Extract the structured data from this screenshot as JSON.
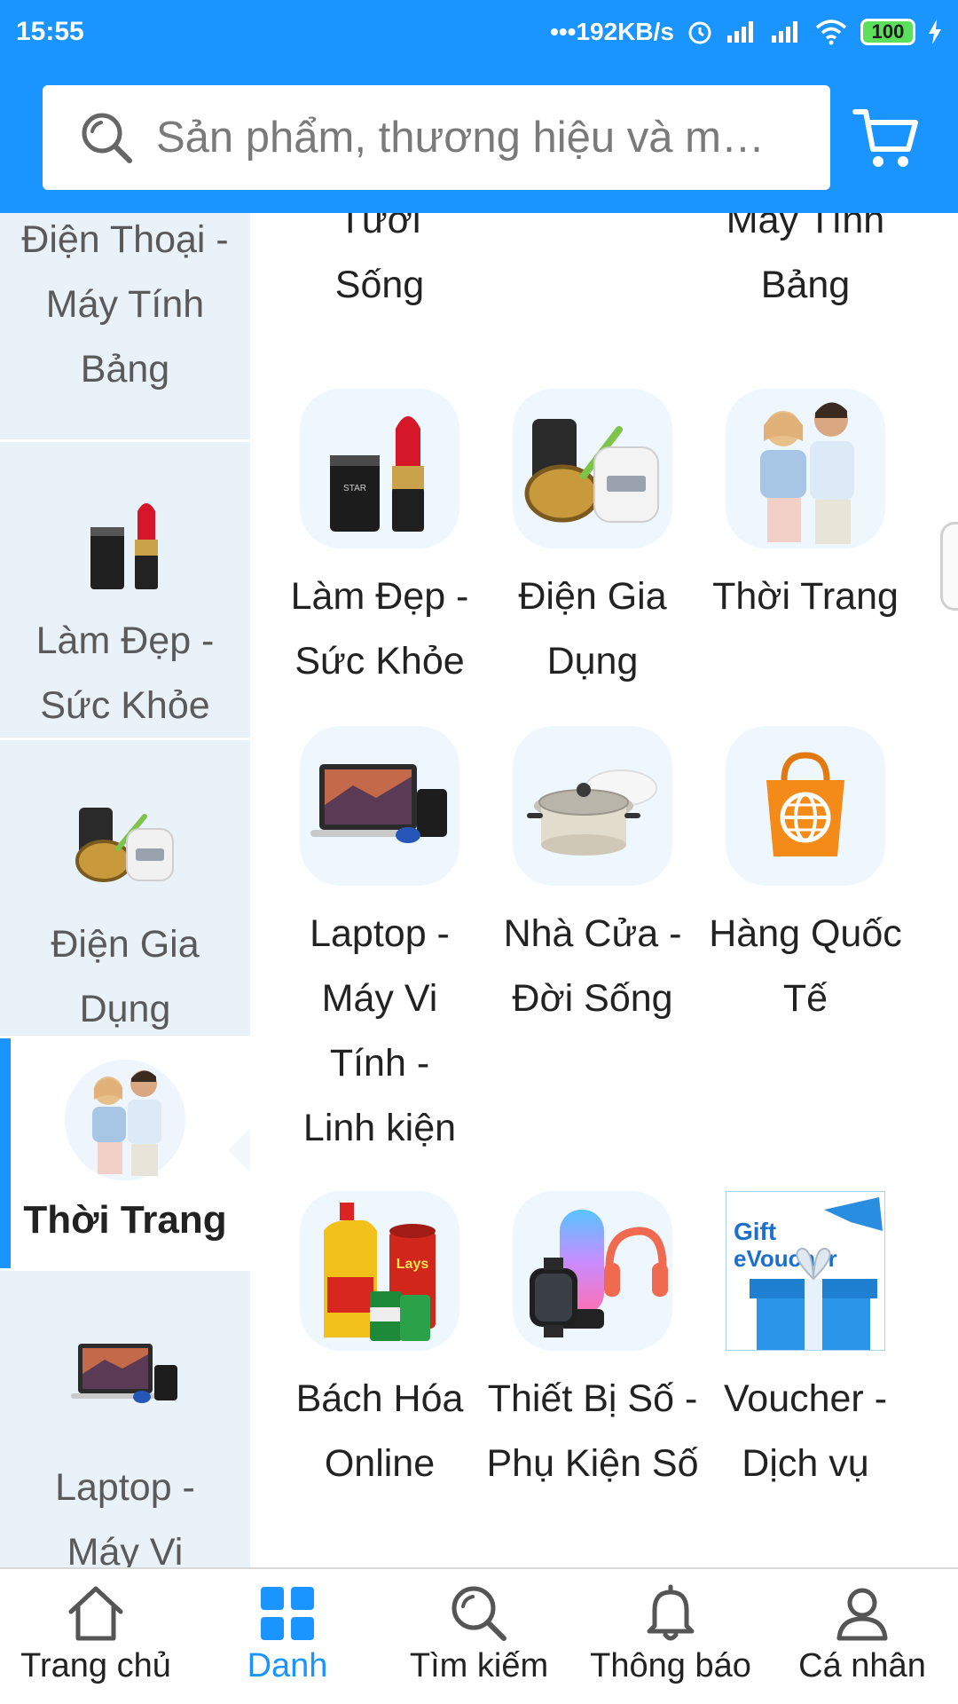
{
  "status": {
    "time": "15:55",
    "network_speed": "•••192KB/s",
    "battery": "100"
  },
  "search": {
    "placeholder": "Sản phẩm, thương hiệu và m…"
  },
  "sidebar": {
    "items": [
      {
        "label": "Điện Thoại - Máy Tính Bảng",
        "icon": "phone-tablet-icon"
      },
      {
        "label": "Làm Đẹp - Sức Khỏe",
        "icon": "lipstick-icon"
      },
      {
        "label": "Điện Gia Dụng",
        "icon": "rice-cooker-icon"
      },
      {
        "label": "Thời Trang",
        "icon": "fashion-couple-icon",
        "active": true
      },
      {
        "label": "Laptop - Máy Vi",
        "icon": "laptop-icon"
      }
    ]
  },
  "grid": {
    "top_partial": [
      {
        "label": "Tươi Sống"
      },
      {
        "label": ""
      },
      {
        "label": "Máy Tính Bảng"
      }
    ],
    "items": [
      {
        "label": "Làm Đẹp - Sức Khỏe",
        "icon": "lipstick-icon"
      },
      {
        "label": "Điện Gia Dụng",
        "icon": "rice-cooker-icon"
      },
      {
        "label": "Thời Trang",
        "icon": "fashion-couple-icon"
      },
      {
        "label": "Laptop - Máy Vi Tính - Linh kiện",
        "icon": "laptop-icon"
      },
      {
        "label": "Nhà Cửa - Đời Sống",
        "icon": "cooking-pot-icon"
      },
      {
        "label": "Hàng Quốc Tế",
        "icon": "globe-bag-icon"
      },
      {
        "label": "Bách Hóa Online",
        "icon": "grocery-icon"
      },
      {
        "label": "Thiết Bị Số - Phụ Kiện Số",
        "icon": "digital-devices-icon"
      },
      {
        "label": "Voucher - Dịch vụ",
        "icon": "gift-voucher-icon"
      }
    ],
    "voucher_text": [
      "Gift",
      "eVoucher"
    ]
  },
  "bottom_nav": [
    {
      "label": "Trang chủ",
      "icon": "home-icon"
    },
    {
      "label": "Danh",
      "icon": "category-grid-icon",
      "active": true
    },
    {
      "label": "Tìm kiếm",
      "icon": "search-icon"
    },
    {
      "label": "Thông báo",
      "icon": "bell-icon"
    },
    {
      "label": "Cá nhân",
      "icon": "user-icon"
    }
  ],
  "colors": {
    "brand": "#1a94ff",
    "sidebar_bg": "#e9f1f9",
    "thumb_bg": "#eef6fe"
  }
}
